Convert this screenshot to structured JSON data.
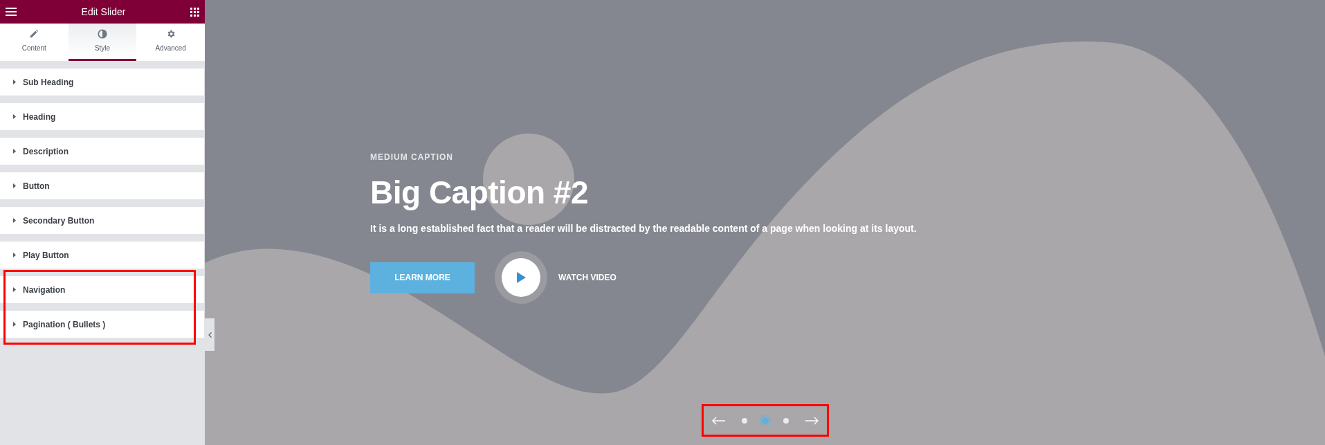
{
  "panel": {
    "title": "Edit Slider",
    "tabs": [
      {
        "label": "Content",
        "kind": "pencil",
        "selected": false
      },
      {
        "label": "Style",
        "kind": "contrast",
        "selected": true
      },
      {
        "label": "Advanced",
        "kind": "gear",
        "selected": false
      }
    ],
    "sections": [
      {
        "label": "Sub Heading",
        "highlighted": false
      },
      {
        "label": "Heading",
        "highlighted": false
      },
      {
        "label": "Description",
        "highlighted": false
      },
      {
        "label": "Button",
        "highlighted": false
      },
      {
        "label": "Secondary Button",
        "highlighted": false
      },
      {
        "label": "Play Button",
        "highlighted": false
      },
      {
        "label": "Navigation",
        "highlighted": true
      },
      {
        "label": "Pagination ( Bullets )",
        "highlighted": true
      }
    ]
  },
  "slide": {
    "subheading": "MEDIUM CAPTION",
    "heading": "Big Caption #2",
    "description": "It is a long established fact that a reader will be distracted by the readable content of a page when looking at its layout.",
    "button": "LEARN MORE",
    "video_label": "WATCH VIDEO",
    "navigation": {
      "highlighted": true,
      "bullets": [
        {
          "selected": false
        },
        {
          "selected": true
        },
        {
          "selected": false
        }
      ]
    }
  }
}
